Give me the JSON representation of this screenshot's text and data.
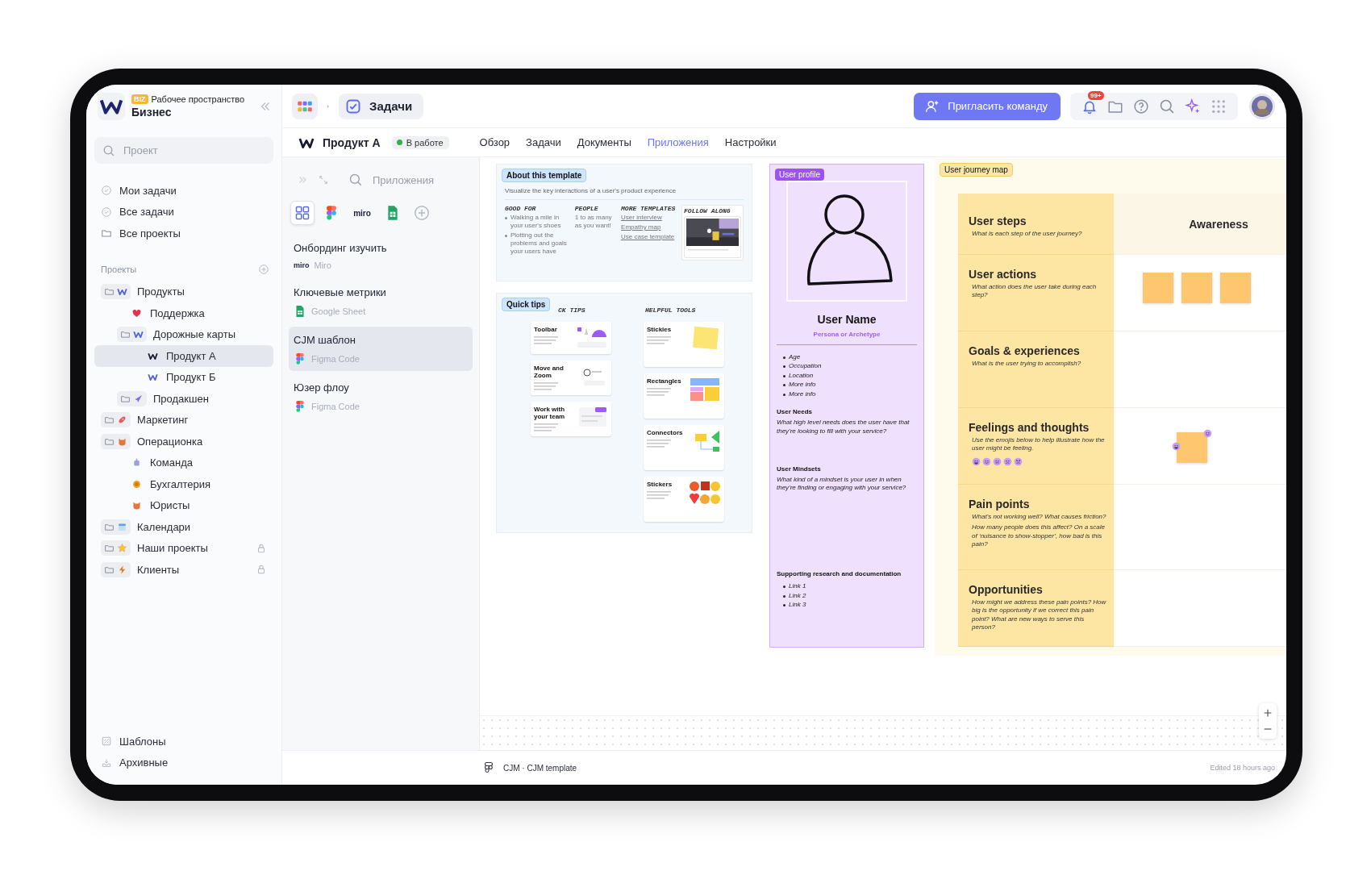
{
  "sidebar": {
    "workspace_badge": "BIZ",
    "workspace_label": "Рабочее пространство",
    "workspace_name": "Бизнес",
    "search": {
      "placeholder": "Проект"
    },
    "nav": [
      {
        "label": "Мои задачи",
        "kind": "check"
      },
      {
        "label": "Все задачи",
        "kind": "check"
      },
      {
        "label": "Все проекты",
        "kind": "folder"
      }
    ],
    "projects_heading": "Проекты",
    "projects": [
      {
        "label": "Продукты",
        "kind": "folder",
        "selected": false,
        "locked": false,
        "children": [
          {
            "label": "Поддержка",
            "kind": "page",
            "selected": false,
            "locked": false
          },
          {
            "label": "Дорожные карты",
            "kind": "folder",
            "selected": false,
            "locked": false,
            "children": [
              {
                "label": "Продукт А",
                "kind": "page",
                "selected": true,
                "locked": false
              },
              {
                "label": "Продукт Б",
                "kind": "page",
                "selected": false,
                "locked": false
              }
            ]
          },
          {
            "label": "Продакшен",
            "kind": "folder",
            "selected": false,
            "locked": false
          }
        ]
      },
      {
        "label": "Маркетинг",
        "kind": "folder",
        "selected": false,
        "locked": false
      },
      {
        "label": "Операционка",
        "kind": "folder",
        "selected": false,
        "locked": false,
        "children": [
          {
            "label": "Команда",
            "kind": "page",
            "selected": false,
            "locked": false
          },
          {
            "label": "Бухгалтерия",
            "kind": "page",
            "selected": false,
            "locked": false
          },
          {
            "label": "Юристы",
            "kind": "page",
            "selected": false,
            "locked": false
          }
        ]
      },
      {
        "label": "Календари",
        "kind": "folder",
        "selected": false,
        "locked": false
      },
      {
        "label": "Наши проекты",
        "kind": "folder",
        "selected": false,
        "locked": true
      },
      {
        "label": "Клиенты",
        "kind": "folder",
        "selected": false,
        "locked": true
      }
    ],
    "footer": [
      {
        "label": "Шаблоны",
        "kind": "templates"
      },
      {
        "label": "Архивные",
        "kind": "archive"
      }
    ]
  },
  "top_bar": {
    "breadcrumb": "Задачи",
    "invite_button": "Пригласить команду",
    "notifications_badge": "99+"
  },
  "project": {
    "title": "Продукт А",
    "status": "В работе",
    "tabs": [
      {
        "label": "Обзор",
        "selected": false
      },
      {
        "label": "Задачи",
        "selected": false
      },
      {
        "label": "Документы",
        "selected": false
      },
      {
        "label": "Приложения",
        "selected": true
      },
      {
        "label": "Настройки",
        "selected": false
      }
    ]
  },
  "apps_panel": {
    "search_placeholder": "Приложения",
    "filters": [
      {
        "kind": "all",
        "selected": true
      },
      {
        "kind": "figma",
        "selected": false
      },
      {
        "kind": "miro",
        "label": "miro",
        "selected": false
      },
      {
        "kind": "sheets",
        "selected": false
      },
      {
        "kind": "add",
        "selected": false
      }
    ],
    "items": [
      {
        "title": "Онбординг изучить",
        "kind": "miro",
        "logo_text": "miro",
        "source": "Miro",
        "selected": false
      },
      {
        "title": "Ключевые метрики",
        "kind": "sheets",
        "source": "Google Sheet",
        "selected": false
      },
      {
        "title": "CJM шаблон",
        "kind": "figma",
        "source": "Figma Code",
        "selected": true
      },
      {
        "title": "Юзер флоу",
        "kind": "figma",
        "source": "Figma Code",
        "selected": false
      }
    ]
  },
  "about_card": {
    "label": "About this template",
    "subtitle": "Visualize the key interactions of a user's product experience",
    "columns": [
      {
        "heading": "GOOD FOR",
        "kind": "bullets",
        "items": [
          "Walking a mile in your user's shoes",
          "Plotting out the problems and goals your users have"
        ]
      },
      {
        "heading": "PEOPLE",
        "kind": "text",
        "items": [
          "1 to as many as you want!"
        ]
      },
      {
        "heading": "MORE TEMPLATES",
        "kind": "links",
        "items": [
          "User interview",
          "Empathy map",
          "Use case template"
        ]
      },
      {
        "heading": "FOLLOW ALONG",
        "kind": "video"
      }
    ]
  },
  "quick_tips": {
    "label": "Quick tips",
    "columns": [
      {
        "heading": "CK TIPS",
        "items": [
          {
            "title": "Toolbar",
            "kind": "toolbar"
          },
          {
            "title": "Move and Zoom",
            "kind": "zoom"
          },
          {
            "title": "Work with your team",
            "kind": "team"
          }
        ]
      },
      {
        "heading": "HELPFUL TOOLS",
        "items": [
          {
            "title": "Stickies",
            "kind": "stickies"
          },
          {
            "title": "Rectangles",
            "kind": "rectangles"
          },
          {
            "title": "Connectors",
            "kind": "connectors"
          },
          {
            "title": "Stickers",
            "kind": "stickers"
          }
        ]
      }
    ]
  },
  "user_profile": {
    "label": "User profile",
    "name": "User Name",
    "role": "Persona or Archetype",
    "facts": [
      "Age",
      "Occupation",
      "Location",
      "More info",
      "More info"
    ],
    "sections": [
      {
        "title": "User Needs",
        "text": "What high level needs does the user have that they're looking to fill with your service?"
      },
      {
        "title": "User Mindsets",
        "text": "What kind of a mindset is your user in when they're finding or engaging with your service?"
      },
      {
        "title": "Supporting research and documentation",
        "links": [
          "Link 1",
          "Link 2",
          "Link 3"
        ]
      }
    ]
  },
  "journey_map": {
    "label": "User journey map",
    "stage": "Awareness",
    "rows": [
      {
        "title": "User steps",
        "kind": "header",
        "hints": [
          "What is each step of the user journey?"
        ]
      },
      {
        "title": "User actions",
        "kind": "stickies",
        "hints": [
          "What action does the user take during each step?"
        ]
      },
      {
        "title": "Goals & experiences",
        "kind": "empty",
        "hints": [
          "What is the user trying to accomplish?"
        ]
      },
      {
        "title": "Feelings and thoughts",
        "kind": "feelings",
        "hints": [
          "Use the emojis below to help illustrate how the user might be feeling."
        ]
      },
      {
        "title": "Pain points",
        "kind": "empty",
        "hints": [
          "What's not working well? What causes friction?",
          "How many people does this affect? On a scale of ‘nuisance to show-stopper’, how bad is this pain?"
        ]
      },
      {
        "title": "Opportunities",
        "kind": "empty",
        "hints": [
          "How might we address these pain points? How big is the opportunity if we correct this pain point? What are new ways to serve this person?"
        ]
      }
    ]
  },
  "bottom_bar": {
    "file": "CJM · CJM template",
    "edited": "Edited 18 hours ago"
  }
}
